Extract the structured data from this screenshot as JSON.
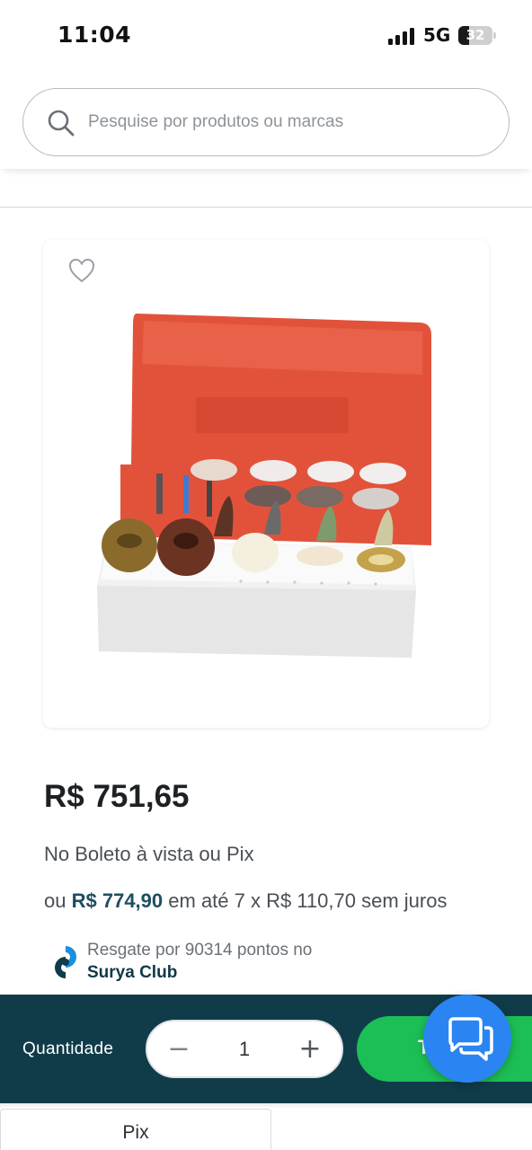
{
  "status_bar": {
    "time": "11:04",
    "network": "5G",
    "battery": "32",
    "battery_level": 0.32
  },
  "search": {
    "placeholder": "Pesquise por produtos ou marcas",
    "icon": "search-icon"
  },
  "product": {
    "favorite_icon": "heart-outline-icon",
    "image_alt": "product-photo",
    "price": "R$ 751,65",
    "payment_note": "No Boleto à vista ou Pix",
    "installments": {
      "prefix": "ou",
      "total": "R$ 774,90",
      "suffix": "em até 7 x R$ 110,70 sem juros"
    },
    "points": {
      "text": "Resgate por 90314 pontos no",
      "club": "Surya Club"
    }
  },
  "purchase_bar": {
    "quantity_label": "Quantidade",
    "quantity_value": "1",
    "minus": "−",
    "plus": "+",
    "buy_label": "T",
    "colors": {
      "bar": "#103c4a",
      "buy": "#1cbf55",
      "chat": "#2a85f2"
    }
  },
  "chat": {
    "icon": "chat-bubbles-icon"
  },
  "tabs": [
    {
      "label": "Pix"
    }
  ]
}
